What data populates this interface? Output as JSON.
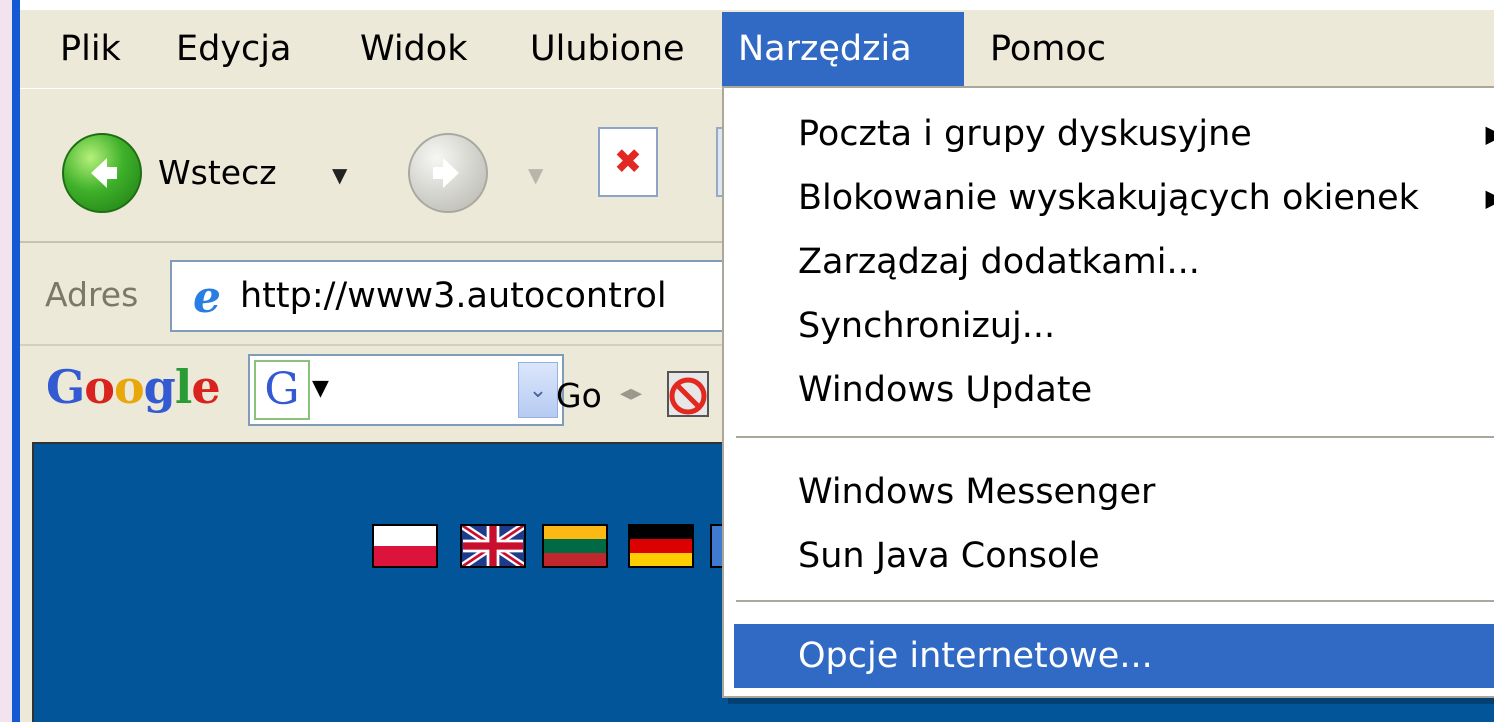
{
  "menubar": {
    "items": [
      {
        "label": "Plik"
      },
      {
        "label": "Edycja"
      },
      {
        "label": "Widok"
      },
      {
        "label": "Ulubione"
      },
      {
        "label": "Narzędzia"
      },
      {
        "label": "Pomoc"
      }
    ],
    "active": "Narzędzia"
  },
  "toolbar": {
    "back_label": "Wstecz"
  },
  "address": {
    "label": "Adres",
    "url": "http://www3.autocontrol"
  },
  "google_bar": {
    "logo": "Google",
    "badge": "G",
    "go_label": "Go"
  },
  "tools_menu": {
    "groups": [
      [
        {
          "label": "Poczta i grupy dyskusyjne",
          "submenu": true
        },
        {
          "label": "Blokowanie wyskakujących okienek",
          "submenu": true
        },
        {
          "label": "Zarządzaj dodatkami...",
          "submenu": false
        },
        {
          "label": "Synchronizuj...",
          "submenu": false
        },
        {
          "label": "Windows Update",
          "submenu": false
        }
      ],
      [
        {
          "label": "Windows Messenger",
          "submenu": false
        },
        {
          "label": "Sun Java Console",
          "submenu": false
        }
      ],
      [
        {
          "label": "Opcje internetowe...",
          "submenu": false,
          "highlighted": true
        }
      ]
    ],
    "submenu_arrow": "▶"
  },
  "icons": {
    "back": "back-arrow-icon",
    "forward": "forward-arrow-icon",
    "stop": "stop-page-icon",
    "ie": "internet-explorer-icon",
    "popup_blocker": "popup-blocker-icon"
  },
  "colors": {
    "selection": "#316ac5",
    "chrome": "#ece9d8",
    "page_background": "#03559a"
  }
}
